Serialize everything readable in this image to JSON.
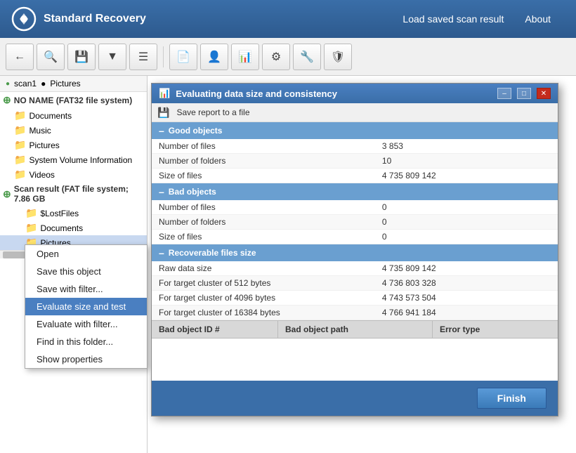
{
  "header": {
    "title": "Standard Recovery",
    "nav": {
      "load": "Load saved scan result",
      "about": "About"
    }
  },
  "breadcrumb": {
    "scan": "scan1",
    "folder": "Pictures"
  },
  "sidebar": {
    "drive": "NO NAME (FAT32 file system)",
    "items": [
      {
        "label": "Documents",
        "indent": 1
      },
      {
        "label": "Music",
        "indent": 1
      },
      {
        "label": "Pictures",
        "indent": 1
      },
      {
        "label": "System Volume Information",
        "indent": 1
      },
      {
        "label": "Videos",
        "indent": 1
      }
    ],
    "scan_result": "Scan result (FAT file system; 7.86 GB",
    "scan_items": [
      {
        "label": "$LostFiles",
        "indent": 2
      },
      {
        "label": "Documents",
        "indent": 2
      },
      {
        "label": "Pictures",
        "indent": 2,
        "selected": true
      }
    ]
  },
  "context_menu": {
    "items": [
      {
        "label": "Open",
        "active": false
      },
      {
        "label": "Save this object",
        "active": false
      },
      {
        "label": "Save with filter...",
        "active": false
      },
      {
        "label": "Evaluate size and test",
        "active": true
      },
      {
        "label": "Evaluate with filter...",
        "active": false
      },
      {
        "label": "Find in this folder...",
        "active": false
      },
      {
        "label": "Show properties",
        "active": false
      }
    ]
  },
  "dialog": {
    "title": "Evaluating data size and consistency",
    "icon": "📊",
    "save_report": "Save report to a file",
    "sections": {
      "good": {
        "label": "Good objects",
        "rows": [
          {
            "key": "Number of files",
            "value": "3 853"
          },
          {
            "key": "Number of folders",
            "value": "10"
          },
          {
            "key": "Size of files",
            "value": "4 735 809 142"
          }
        ]
      },
      "bad": {
        "label": "Bad objects",
        "rows": [
          {
            "key": "Number of files",
            "value": "0"
          },
          {
            "key": "Number of folders",
            "value": "0"
          },
          {
            "key": "Size of files",
            "value": "0"
          }
        ]
      },
      "recoverable": {
        "label": "Recoverable files size",
        "rows": [
          {
            "key": "Raw data size",
            "value": "4 735 809 142"
          },
          {
            "key": "For target cluster of 512 bytes",
            "value": "4 736 803 328"
          },
          {
            "key": "For target cluster of 4096 bytes",
            "value": "4 743 573 504"
          },
          {
            "key": "For target cluster of 16384 bytes",
            "value": "4 766 941 184"
          }
        ]
      }
    },
    "bad_table": {
      "columns": [
        "Bad object ID #",
        "Bad object path",
        "Error type"
      ]
    },
    "finish_label": "Finish"
  }
}
